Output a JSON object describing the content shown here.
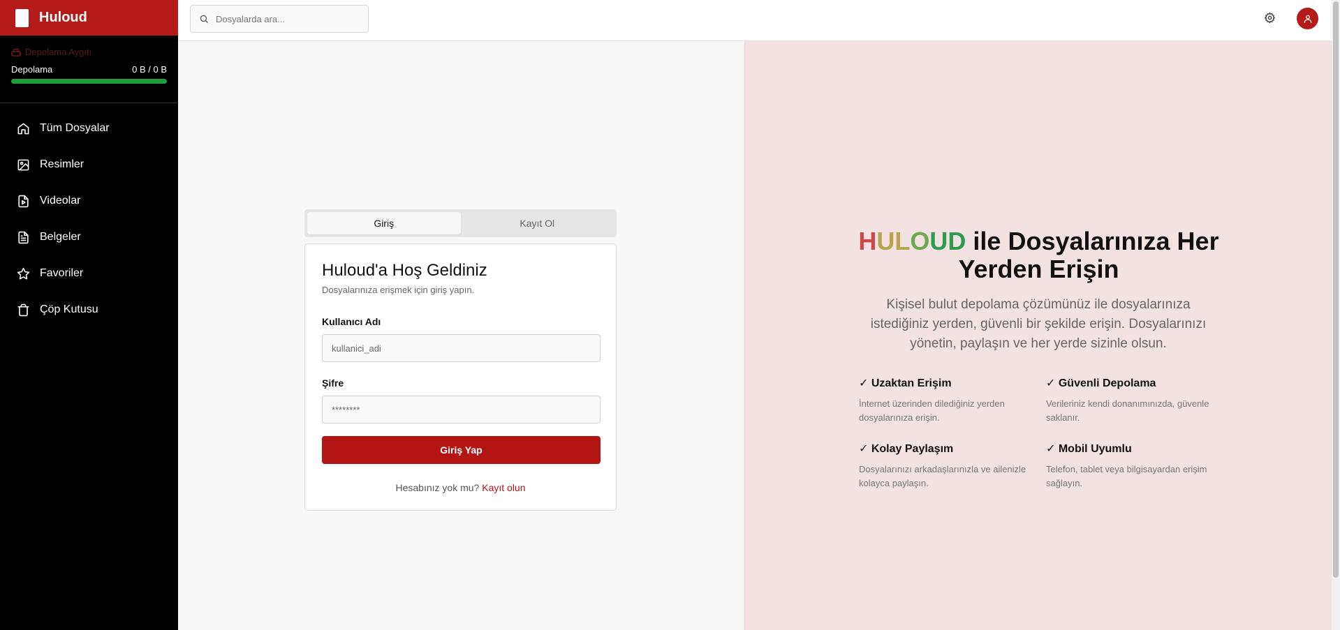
{
  "brand": {
    "name": "Huloud"
  },
  "storage": {
    "device_label": "Depolama Aygıtı",
    "label": "Depolama",
    "usage": "0 B / 0 B"
  },
  "nav": [
    {
      "label": "Tüm Dosyalar",
      "icon": "home-icon"
    },
    {
      "label": "Resimler",
      "icon": "image-icon"
    },
    {
      "label": "Videolar",
      "icon": "video-file-icon"
    },
    {
      "label": "Belgeler",
      "icon": "document-icon"
    },
    {
      "label": "Favoriler",
      "icon": "star-icon"
    },
    {
      "label": "Çöp Kutusu",
      "icon": "trash-icon"
    }
  ],
  "search": {
    "placeholder": "Dosyalarda ara..."
  },
  "auth": {
    "tabs": [
      "Giriş",
      "Kayıt Ol"
    ],
    "title": "Huloud'a Hoş Geldiniz",
    "subtitle": "Dosyalarınıza erişmek için giriş yapın.",
    "username_label": "Kullanıcı Adı",
    "username_placeholder": "kullanici_adi",
    "password_label": "Şifre",
    "password_placeholder": "********",
    "submit": "Giriş Yap",
    "no_account": "Hesabınız yok mu?",
    "register_link": "Kayıt olun"
  },
  "hero": {
    "brand_letters": [
      "H",
      "UL",
      "O",
      "UD"
    ],
    "title_rest_1": " ile Dosyalarınıza Her",
    "title_rest_2": "Yerden Erişin",
    "description": "Kişisel bulut depolama çözümünüz ile dosyalarınıza istediğiniz yerden, güvenli bir şekilde erişin. Dosyalarınızı yönetin, paylaşın ve her yerde sizinle olsun."
  },
  "features": [
    {
      "title": "✓ Uzaktan Erişim",
      "text": "İnternet üzerinden dilediğiniz yerden dosyalarınıza erişin."
    },
    {
      "title": "✓ Güvenli Depolama",
      "text": "Verileriniz kendi donanımınızda, güvenle saklanır."
    },
    {
      "title": "✓ Kolay Paylaşım",
      "text": "Dosyalarınızı arkadaşlarınızla ve ailenizle kolayca paylaşın."
    },
    {
      "title": "✓ Mobil Uyumlu",
      "text": "Telefon, tablet veya bilgisayardan erişim sağlayın."
    }
  ],
  "colors": {
    "brand_red": "#b31b1b",
    "storage_bar": "#1f9d3a",
    "hero_bg": "#f3e2e2"
  }
}
